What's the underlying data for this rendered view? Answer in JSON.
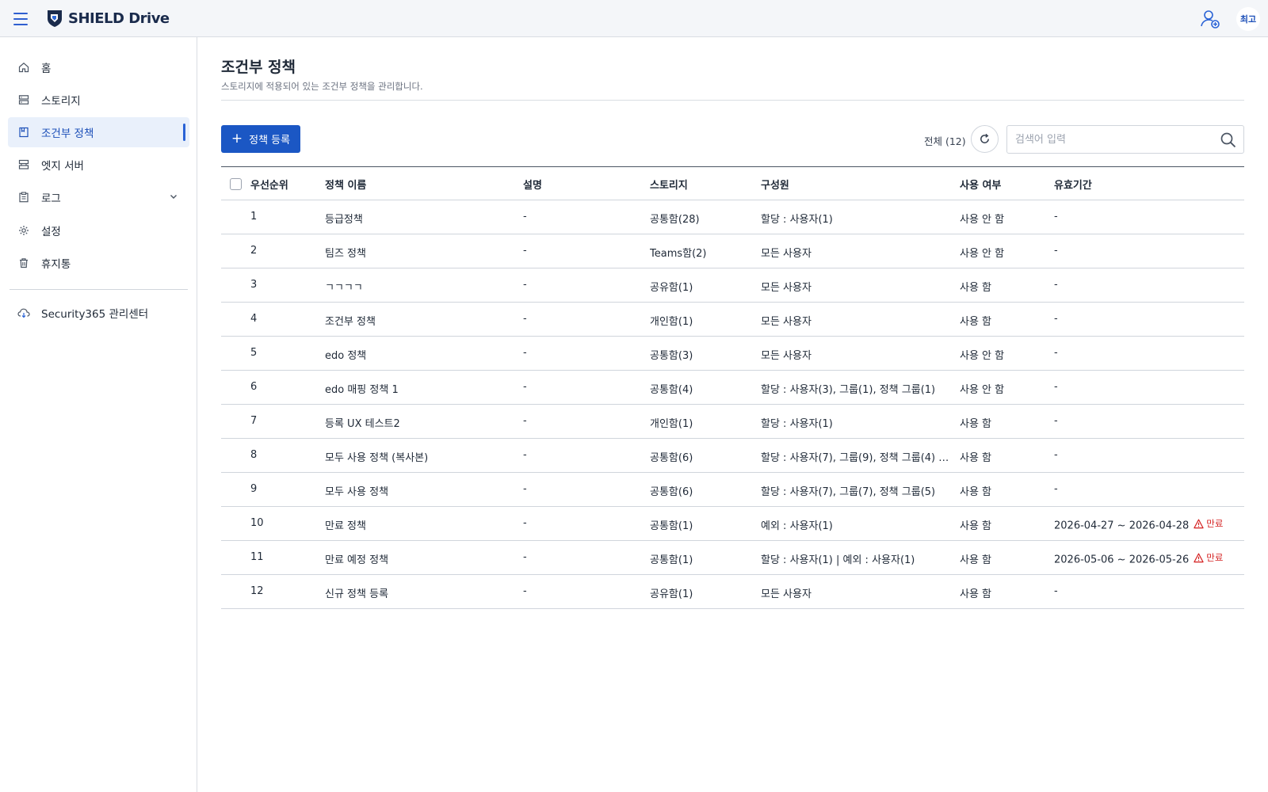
{
  "header": {
    "logo_text": "SHIELD Drive",
    "avatar_text": "최고"
  },
  "sidebar": {
    "items": [
      {
        "label": "홈",
        "icon": "home-icon"
      },
      {
        "label": "스토리지",
        "icon": "storage-icon"
      },
      {
        "label": "조건부 정책",
        "icon": "policy-icon",
        "active": true
      },
      {
        "label": "엣지 서버",
        "icon": "server-icon"
      },
      {
        "label": "로그",
        "icon": "log-icon",
        "expandable": true
      },
      {
        "label": "설정",
        "icon": "gear-icon"
      },
      {
        "label": "휴지통",
        "icon": "trash-icon"
      }
    ],
    "external_link": {
      "label": "Security365 관리센터",
      "icon": "cloud-icon"
    }
  },
  "page": {
    "title": "조건부 정책",
    "subtitle": "스토리지에 적용되어 있는 조건부 정책을 관리합니다."
  },
  "toolbar": {
    "add_label": "정책 등록",
    "total_label": "전체 (12)",
    "search_placeholder": "검색어 입력"
  },
  "table": {
    "columns": [
      "우선순위",
      "정책 이름",
      "설명",
      "스토리지",
      "구성원",
      "사용 여부",
      "유효기간"
    ],
    "rows": [
      {
        "priority": "1",
        "name": "등급정책",
        "desc": "-",
        "storage": "공통함(28)",
        "members": "할당 : 사용자(1)",
        "usage": "사용 안 함",
        "period": "-"
      },
      {
        "priority": "2",
        "name": "팀즈 정책",
        "desc": "-",
        "storage": "Teams함(2)",
        "members": "모든 사용자",
        "usage": "사용 안 함",
        "period": "-"
      },
      {
        "priority": "3",
        "name": "ㄱㄱㄱㄱ",
        "desc": "-",
        "storage": "공유함(1)",
        "members": "모든 사용자",
        "usage": "사용 함",
        "period": "-"
      },
      {
        "priority": "4",
        "name": "조건부 정책",
        "desc": "-",
        "storage": "개인함(1)",
        "members": "모든 사용자",
        "usage": "사용 함",
        "period": "-"
      },
      {
        "priority": "5",
        "name": "edo 정책",
        "desc": "-",
        "storage": "공통함(3)",
        "members": "모든 사용자",
        "usage": "사용 안 함",
        "period": "-"
      },
      {
        "priority": "6",
        "name": "edo 매핑 정책 1",
        "desc": "-",
        "storage": "공통함(4)",
        "members": "할당 : 사용자(3), 그룹(1), 정책 그룹(1)",
        "usage": "사용 안 함",
        "period": "-"
      },
      {
        "priority": "7",
        "name": "등록 UX 테스트2",
        "desc": "-",
        "storage": "개인함(1)",
        "members": "할당 : 사용자(1)",
        "usage": "사용 함",
        "period": "-"
      },
      {
        "priority": "8",
        "name": "모두 사용 정책 (복사본)",
        "desc": "-",
        "storage": "공통함(6)",
        "members": "할당 : 사용자(7), 그룹(9), 정책 그룹(4) …",
        "usage": "사용 함",
        "period": "-"
      },
      {
        "priority": "9",
        "name": "모두 사용 정책",
        "desc": "-",
        "storage": "공통함(6)",
        "members": "할당 : 사용자(7), 그룹(7), 정책 그룹(5)",
        "usage": "사용 함",
        "period": "-"
      },
      {
        "priority": "10",
        "name": "만료 정책",
        "desc": "-",
        "storage": "공통함(1)",
        "members": "예외 : 사용자(1)",
        "usage": "사용 함",
        "period": "2026-04-27 ~ 2026-04-28",
        "expired": "만료"
      },
      {
        "priority": "11",
        "name": "만료 예정 정책",
        "desc": "-",
        "storage": "공통함(1)",
        "members": "할당 : 사용자(1) | 예외 : 사용자(1)",
        "usage": "사용 함",
        "period": "2026-05-06 ~ 2026-05-26",
        "expired": "만료"
      },
      {
        "priority": "12",
        "name": "신규 정책 등록",
        "desc": "-",
        "storage": "공유함(1)",
        "members": "모든 사용자",
        "usage": "사용 함",
        "period": "-"
      }
    ]
  },
  "colors": {
    "accent": "#1b57c4",
    "active_bg": "#e9f0fb",
    "expired": "#d41f1f",
    "header_bg": "#f4f6f9"
  }
}
